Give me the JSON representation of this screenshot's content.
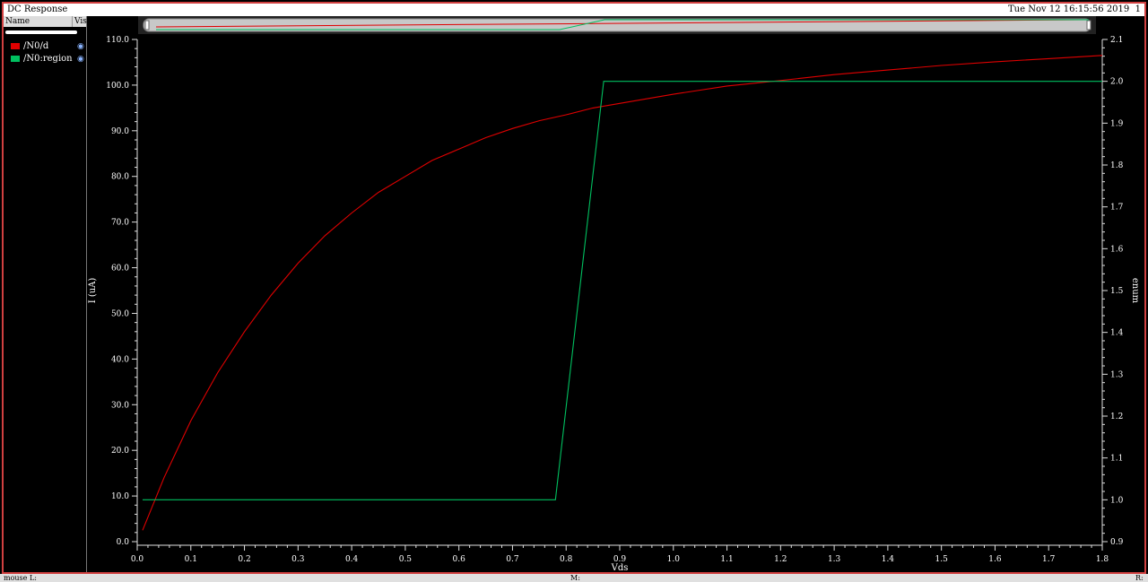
{
  "window": {
    "title": "DC Response",
    "timestamp": "Tue Nov 12 16:15:56 2019",
    "page_number": "1"
  },
  "panel": {
    "col_name": "Name",
    "col_vis": "Vis"
  },
  "legend": [
    {
      "label": "/N0/d",
      "color": "#e00000"
    },
    {
      "label": "/N0:region",
      "color": "#00c060"
    }
  ],
  "statusbar": {
    "left": "mouse L:",
    "mid": "M:",
    "right": "R:"
  },
  "colors": {
    "frame": "#d04040",
    "axis": "#e0e0e0",
    "grid": "#2a2a2a"
  },
  "chart_data": {
    "type": "line",
    "xlabel": "Vds",
    "ylabel": "I (uA)",
    "y2label": "enum",
    "xlim": [
      0.0,
      1.8
    ],
    "ylim": [
      0.0,
      110.0
    ],
    "y2lim": [
      0.9,
      2.1
    ],
    "x_ticks": [
      "0.0",
      "0.1",
      "0.2",
      "0.3",
      "0.4",
      "0.5",
      "0.6",
      "0.7",
      "0.8",
      "0.9",
      "1.0",
      "1.1",
      "1.2",
      "1.3",
      "1.4",
      "1.5",
      "1.6",
      "1.7",
      "1.8"
    ],
    "y_ticks": [
      "0.0",
      "10.0",
      "20.0",
      "30.0",
      "40.0",
      "50.0",
      "60.0",
      "70.0",
      "80.0",
      "90.0",
      "100.0",
      "110.0"
    ],
    "y2_ticks": [
      "0.9",
      "1.0",
      "1.1",
      "1.2",
      "1.3",
      "1.4",
      "1.5",
      "1.6",
      "1.7",
      "1.8",
      "1.9",
      "2.0",
      "2.1"
    ],
    "grid": false,
    "series": [
      {
        "name": "/N0/d",
        "axis": "left",
        "color": "#e00000",
        "x": [
          0.01,
          0.05,
          0.1,
          0.15,
          0.2,
          0.25,
          0.3,
          0.35,
          0.4,
          0.45,
          0.5,
          0.55,
          0.6,
          0.65,
          0.7,
          0.75,
          0.8,
          0.85,
          0.9,
          1.0,
          1.1,
          1.2,
          1.3,
          1.4,
          1.5,
          1.6,
          1.7,
          1.8
        ],
        "y": [
          2.5,
          14.0,
          26.5,
          37.0,
          46.0,
          54.0,
          61.0,
          67.0,
          72.0,
          76.5,
          80.0,
          83.5,
          86.0,
          88.5,
          90.5,
          92.2,
          93.5,
          95.0,
          96.0,
          98.0,
          99.8,
          101.0,
          102.3,
          103.3,
          104.3,
          105.1,
          105.8,
          106.5
        ]
      },
      {
        "name": "/N0:region",
        "axis": "right",
        "color": "#00c060",
        "x": [
          0.01,
          0.78,
          0.87,
          1.8
        ],
        "y": [
          1.0,
          1.0,
          2.0,
          2.0
        ]
      }
    ]
  }
}
